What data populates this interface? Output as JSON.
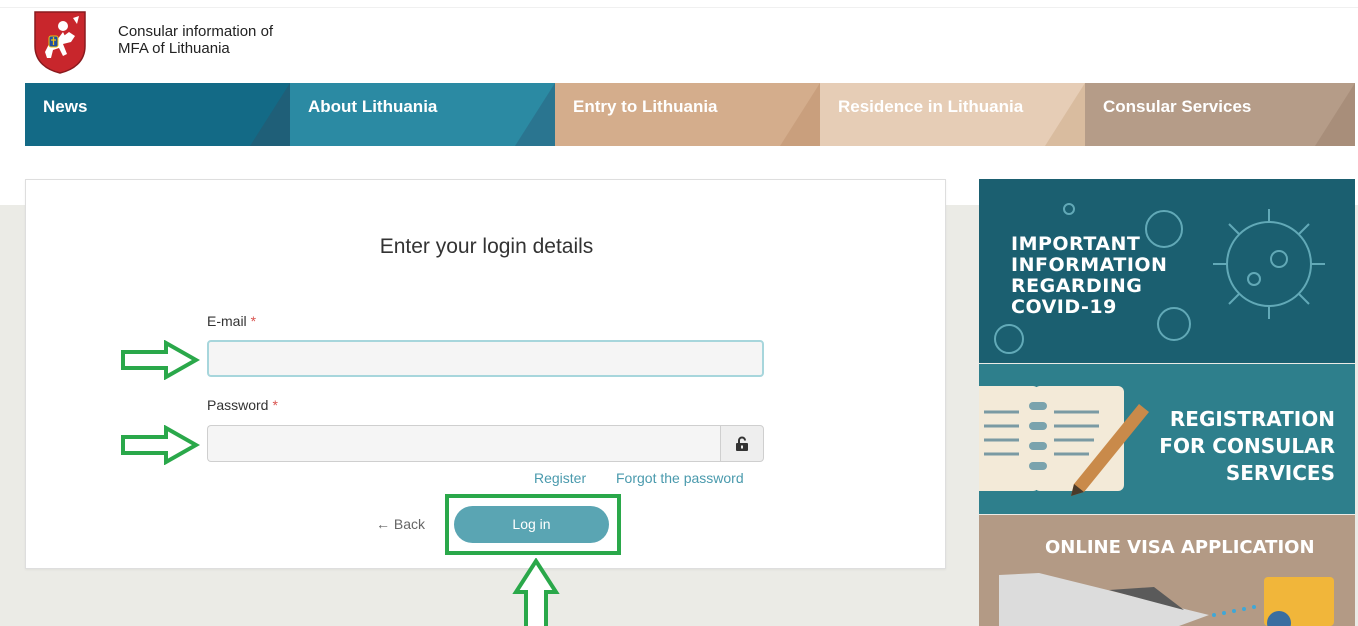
{
  "header": {
    "title_line1": "Consular information of",
    "title_line2": "MFA of Lithuania"
  },
  "nav": {
    "items": [
      {
        "label": "News"
      },
      {
        "label": "About Lithuania"
      },
      {
        "label": "Entry to Lithuania"
      },
      {
        "label": "Residence in Lithuania"
      },
      {
        "label": "Consular Services"
      }
    ]
  },
  "login": {
    "title": "Enter your login details",
    "email_label": "E-mail",
    "password_label": "Password",
    "required_marker": "*",
    "email_value": "",
    "password_value": "",
    "register_link": "Register",
    "forgot_link": "Forgot the password",
    "back_label": "← Back",
    "login_button": "Log in"
  },
  "banners": {
    "covid": {
      "line1": "IMPORTANT",
      "line2": "INFORMATION",
      "line3": "REGARDING",
      "line4": "COVID-19"
    },
    "registration": {
      "line1": "REGISTRATION",
      "line2": "FOR CONSULAR",
      "line3": "SERVICES"
    },
    "visa": {
      "line1": "ONLINE VISA APPLICATION"
    }
  },
  "annotations": {
    "arrow_color": "#2aa84a"
  }
}
